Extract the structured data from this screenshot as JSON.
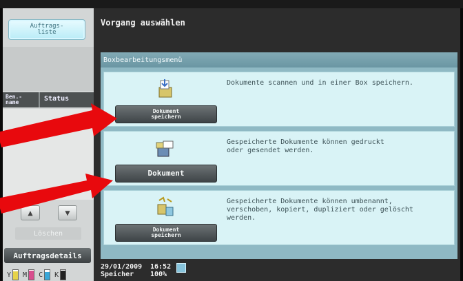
{
  "left_panel": {
    "job_list_button": "Auftrags-\nliste",
    "col_name": "Ben.-\nname",
    "col_status": "Status",
    "delete_label": "Löschen",
    "job_details_label": "Auftragsdetails",
    "toners": [
      {
        "label": "Y",
        "level": 0.85,
        "color": "#e6d34a"
      },
      {
        "label": "M",
        "level": 0.9,
        "color": "#d84d8e"
      },
      {
        "label": "C",
        "level": 0.8,
        "color": "#39a7d8"
      },
      {
        "label": "K",
        "level": 0.95,
        "color": "#222222"
      }
    ]
  },
  "main": {
    "title": "Vorgang auswählen",
    "menu_header": "Boxbearbeitungsmenü",
    "rows": [
      {
        "button": "Dokument\nspeichern",
        "text": "Dokumente scannen und in einer Box speichern."
      },
      {
        "button": "Dokument",
        "text": "Gespeicherte Dokumente können gedruckt\noder gesendet werden."
      },
      {
        "button": "Dokument\nspeichern",
        "text": "Gespeicherte Dokumente können umbenannt,\nverschoben, kopiert, dupliziert oder gelöscht\nwerden."
      }
    ]
  },
  "status_bar": {
    "date": "29/01/2009",
    "time": "16:52",
    "memory_label": "Speicher",
    "memory_value": "100%"
  }
}
